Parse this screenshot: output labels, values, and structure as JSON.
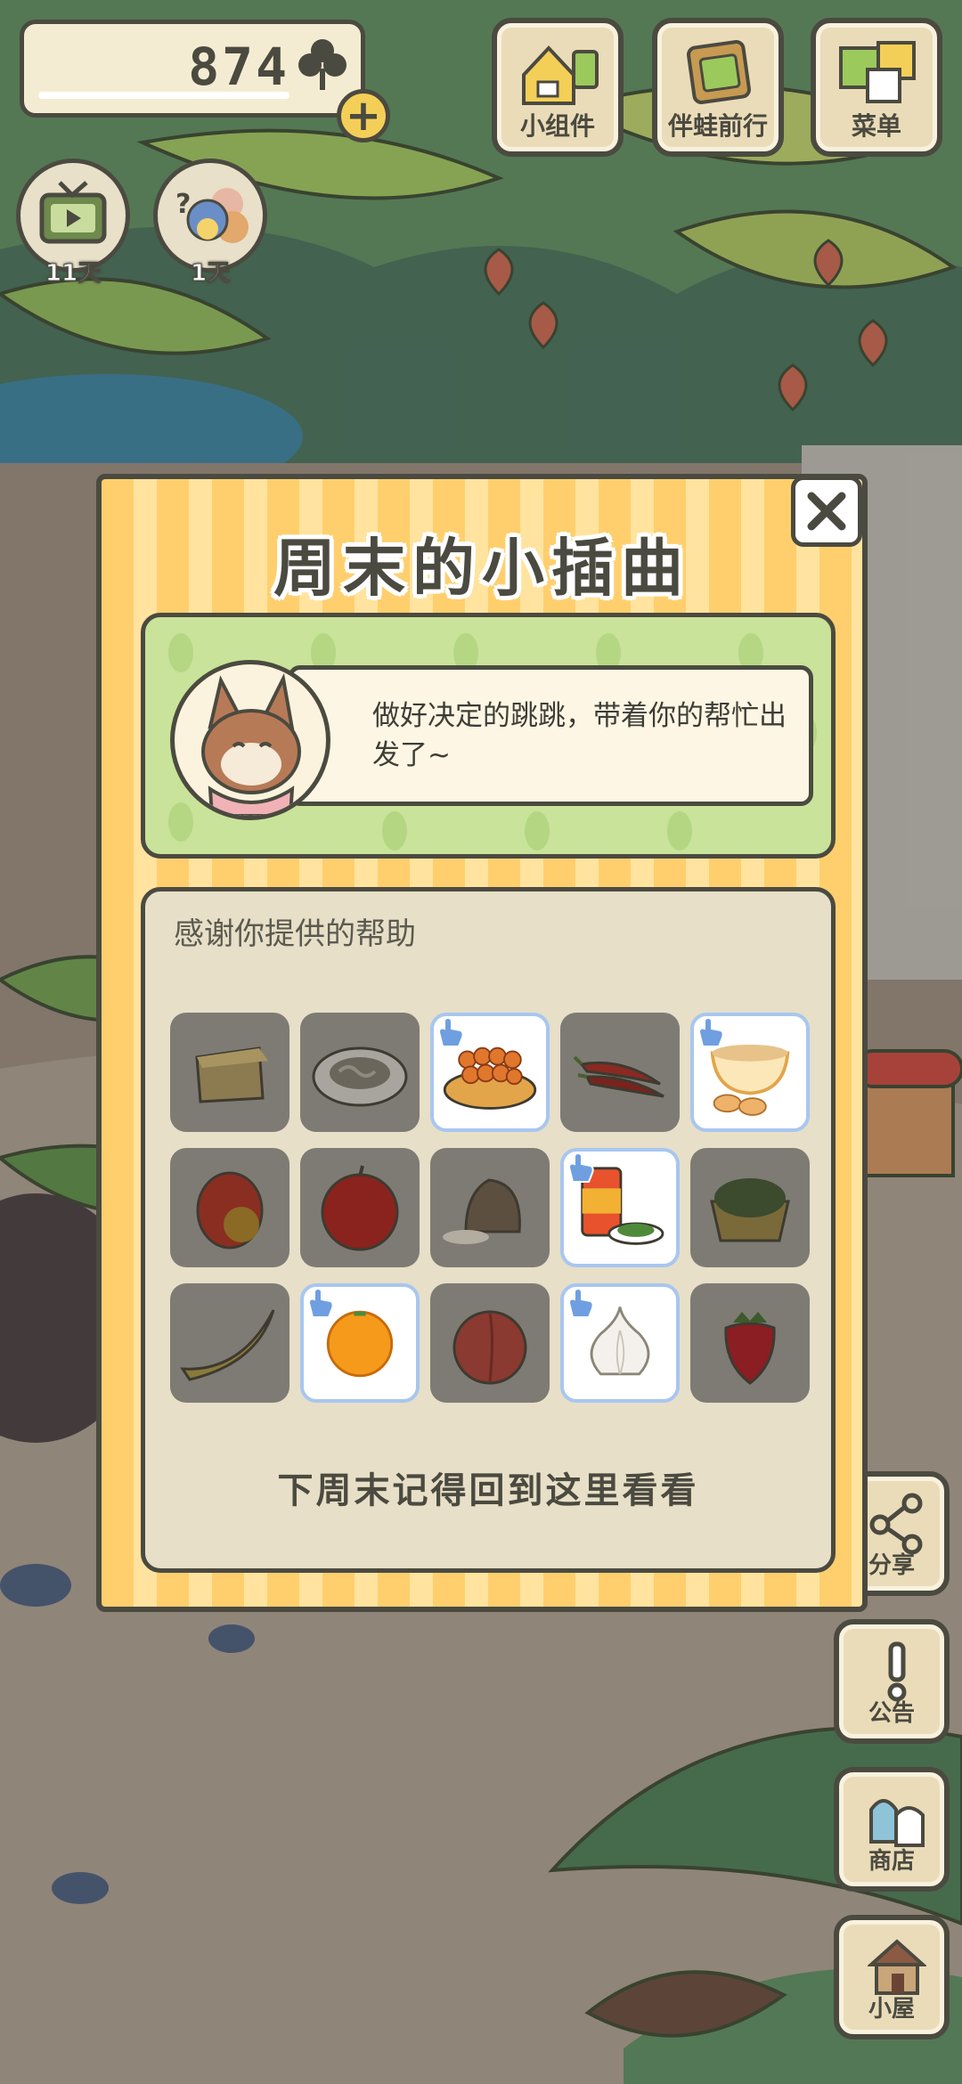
{
  "hud": {
    "clover_count": "874",
    "badges": [
      {
        "label": "11天",
        "icon": "tv-icon"
      },
      {
        "label": "1天",
        "icon": "visitors-icon"
      }
    ]
  },
  "top_buttons": [
    {
      "label": "小组件",
      "icon": "widget-icon"
    },
    {
      "label": "伴蛙前行",
      "icon": "journey-icon"
    },
    {
      "label": "菜单",
      "icon": "menu-cards-icon"
    }
  ],
  "side_buttons": [
    {
      "label": "分享",
      "icon": "share-icon"
    },
    {
      "label": "公告",
      "icon": "notice-icon"
    },
    {
      "label": "商店",
      "icon": "shop-icon"
    },
    {
      "label": "小屋",
      "icon": "house-icon"
    }
  ],
  "modal": {
    "title": "周末的小插曲",
    "message": "做好决定的跳跳，带着你的帮忙出发了~",
    "thanks_header": "感谢你提供的帮助",
    "footer": "下周末记得回到这里看看",
    "items": [
      {
        "name": "cheese",
        "selected": false
      },
      {
        "name": "noodle-plate",
        "selected": false
      },
      {
        "name": "fried-dough-plate",
        "selected": true
      },
      {
        "name": "chili-peppers",
        "selected": false
      },
      {
        "name": "tea-and-biscuits",
        "selected": true
      },
      {
        "name": "mango",
        "selected": false
      },
      {
        "name": "apple",
        "selected": false
      },
      {
        "name": "rice-sack",
        "selected": false
      },
      {
        "name": "canned-seaweed",
        "selected": true
      },
      {
        "name": "noodle-bowl",
        "selected": false
      },
      {
        "name": "banana",
        "selected": false
      },
      {
        "name": "orange",
        "selected": true
      },
      {
        "name": "peach",
        "selected": false
      },
      {
        "name": "garlic",
        "selected": true
      },
      {
        "name": "strawberry",
        "selected": false
      }
    ]
  },
  "colors": {
    "outline": "#4b4a40",
    "stripe_a": "#ffcf6e",
    "stripe_b": "#ffe39e",
    "speech_panel": "#c9e39a",
    "thanks_panel": "#e7dfc7",
    "cell_locked": "#7d7b74",
    "cell_selected_border": "#a8c6f0"
  }
}
